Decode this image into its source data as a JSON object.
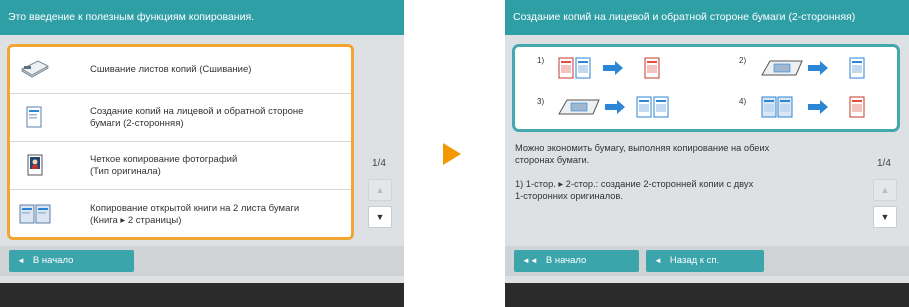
{
  "left_screen": {
    "title": "Это введение к полезным функциям копирования.",
    "items": [
      {
        "label": "Сшивание листов копий (Сшивание)",
        "icon": "stapler-icon"
      },
      {
        "label": "Создание копий на лицевой и обратной стороне\nбумаги (2-сторонняя)",
        "icon": "two-sided-copy-icon"
      },
      {
        "label": "Четкое копирование фотографий\n(Тип оригинала)",
        "icon": "photo-original-icon"
      },
      {
        "label": "Копирование открытой книги на 2 листа бумаги\n(Книга ▸ 2 страницы)",
        "icon": "book-copy-icon"
      }
    ],
    "page_indicator": "1/4",
    "nav_home": "В начало",
    "nav_home_glyph": "◄"
  },
  "right_screen": {
    "title": "Создание копий на лицевой и обратной стороне бумаги (2-сторонняя)",
    "diagram_labels": [
      "1)",
      "2)",
      "3)",
      "4)"
    ],
    "description": "Можно экономить бумагу, выполняя копирование на обеих\nсторонах бумаги.\n\n1) 1-стор. ▸ 2-стор.: создание 2-сторонней копии с двух\n1-сторонних оригиналов.",
    "page_indicator": "1/4",
    "nav_home": "В начало",
    "nav_home_glyph": "◄◄",
    "nav_back": "Назад к сп.",
    "nav_back_glyph": "◄"
  },
  "colors": {
    "accent_teal": "#2f9fa6",
    "highlight_orange": "#f3a532",
    "arrow_blue": "#2b86d6",
    "arrow_orange": "#f39800"
  }
}
